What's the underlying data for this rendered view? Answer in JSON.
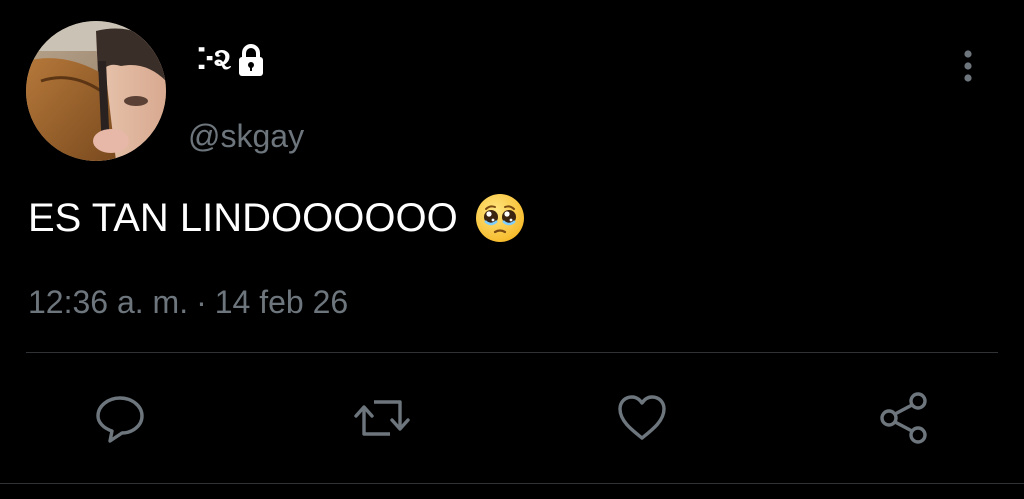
{
  "tweet": {
    "author": {
      "display_name": "ⴾ૨",
      "handle": "@skgay",
      "protected_icon": "lock-icon",
      "avatar_icon": "profile-photo"
    },
    "text": "ES TAN LINDOOOOOO",
    "emoji": "pleading-face-emoji",
    "time": "12:36 a. m.",
    "separator": "·",
    "date": "14 feb 26"
  },
  "actions": [
    {
      "icon": "reply-icon"
    },
    {
      "icon": "retweet-icon"
    },
    {
      "icon": "like-icon"
    },
    {
      "icon": "share-icon"
    }
  ],
  "colors": {
    "background": "#000000",
    "primary_text": "#ffffff",
    "secondary_text": "#6e767d",
    "divider": "#2f3336",
    "icon": "#6e767d"
  }
}
